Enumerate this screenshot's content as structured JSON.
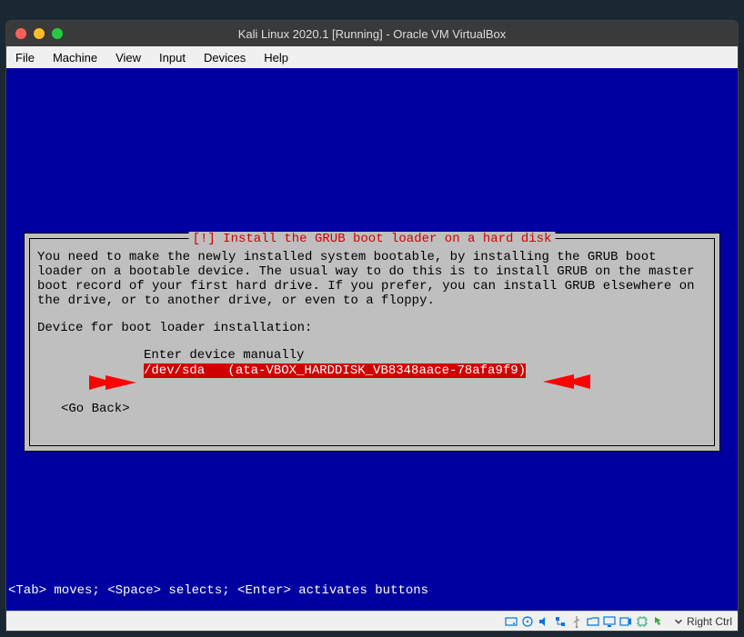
{
  "window": {
    "title": "Kali Linux 2020.1 [Running] - Oracle VM VirtualBox"
  },
  "menu": {
    "file": "File",
    "machine": "Machine",
    "view": "View",
    "input": "Input",
    "devices": "Devices",
    "help": "Help"
  },
  "installer": {
    "title": "[!] Install the GRUB boot loader on a hard disk",
    "instructions": "You need to make the newly installed system bootable, by installing the GRUB boot loader on a bootable device. The usual way to do this is to install GRUB on the master boot record of your first hard drive. If you prefer, you can install GRUB elsewhere on the drive, or to another drive, or even to a floppy.",
    "prompt": "Device for boot loader installation:",
    "options": {
      "manual": "Enter device manually",
      "device": "/dev/sda   (ata-VBOX_HARDDISK_VB8348aace-78afa9f9)"
    },
    "go_back": "<Go Back>"
  },
  "hint": "<Tab> moves; <Space> selects; <Enter> activates buttons",
  "status": {
    "host_key": "Right Ctrl"
  }
}
